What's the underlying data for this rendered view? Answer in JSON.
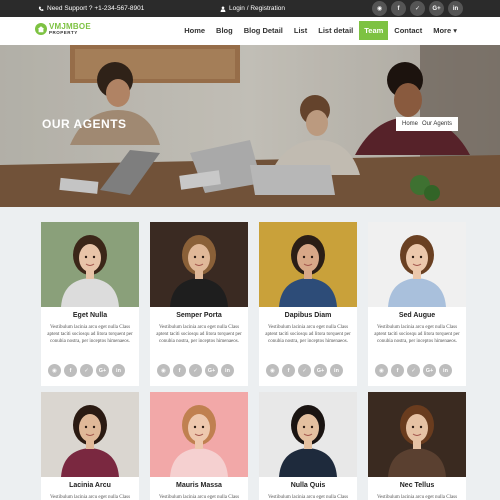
{
  "topbar": {
    "support_text": "Need Support ? +1-234-567-8901",
    "login_text": "Login / Registration",
    "social": [
      {
        "icon": "rss-icon",
        "label": "◉"
      },
      {
        "icon": "facebook-icon",
        "label": "f"
      },
      {
        "icon": "twitter-icon",
        "label": "✓"
      },
      {
        "icon": "google-plus-icon",
        "label": "G+"
      },
      {
        "icon": "linkedin-icon",
        "label": "in"
      }
    ]
  },
  "header": {
    "logo_name": "VMJMBOE",
    "logo_sub": "PROPERTY",
    "nav": [
      {
        "label": "Home"
      },
      {
        "label": "Blog"
      },
      {
        "label": "Blog Detail"
      },
      {
        "label": "List"
      },
      {
        "label": "List detail"
      },
      {
        "label": "Team",
        "active": true
      },
      {
        "label": "Contact"
      },
      {
        "label": "More ▾"
      }
    ]
  },
  "hero": {
    "title": "OUR AGENTS",
    "breadcrumb": [
      "Home",
      "Our Agents"
    ]
  },
  "card_social": [
    "◉",
    "f",
    "✓",
    "G+",
    "in"
  ],
  "agents": [
    {
      "name": "Eget Nulla",
      "desc": "Vestibulum lacinia arcu eget nulla Class aptent taciti sociosqu ad litora torquent per conubia nostra, per inceptos himenaeos.",
      "bg": "#8aa07a",
      "skin": "#e8c4a8",
      "hair": "#3b2618",
      "shirt": "#dcdcdc"
    },
    {
      "name": "Semper Porta",
      "desc": "Vestibulum lacinia arcu eget nulla Class aptent taciti sociosqu ad litora torquent per conubia nostra, per inceptos himenaeos.",
      "bg": "#3a2a22",
      "skin": "#e0b898",
      "hair": "#8a6038",
      "shirt": "#1e1e1e"
    },
    {
      "name": "Dapibus Diam",
      "desc": "Vestibulum lacinia arcu eget nulla Class aptent taciti sociosqu ad litora torquent per conubia nostra, per inceptos himenaeos.",
      "bg": "#c9a13a",
      "skin": "#d8a888",
      "hair": "#2a1e16",
      "shirt": "#2d4c78"
    },
    {
      "name": "Sed Augue",
      "desc": "Vestibulum lacinia arcu eget nulla Class aptent taciti sociosqu ad litora torquent per conubia nostra, per inceptos himenaeos.",
      "bg": "#f0f0f0",
      "skin": "#ecc8ac",
      "hair": "#6a4022",
      "shirt": "#a9c0dc"
    },
    {
      "name": "Lacinia Arcu",
      "desc": "Vestibulum lacinia arcu eget nulla Class aptent taciti sociosqu ad litora torquent per conubia nostra,",
      "bg": "#dad6d0",
      "skin": "#e0b898",
      "hair": "#2a1a12",
      "shirt": "#7a2840"
    },
    {
      "name": "Mauris Massa",
      "desc": "Vestibulum lacinia arcu eget nulla Class aptent taciti sociosqu ad litora torquent per conubia nostra,",
      "bg": "#f2a8a8",
      "skin": "#eec8ae",
      "hair": "#c08050",
      "shirt": "#f5d0d0"
    },
    {
      "name": "Nulla Quis",
      "desc": "Vestibulum lacinia arcu eget nulla Class aptent taciti sociosqu ad litora torquent per conubia nostra,",
      "bg": "#e8e8e8",
      "skin": "#e4c0a0",
      "hair": "#1a1412",
      "shirt": "#1e2a3c"
    },
    {
      "name": "Nec Tellus",
      "desc": "Vestibulum lacinia arcu eget nulla Class aptent taciti sociosqu ad litora torquent per conubia nostra,",
      "bg": "#3a2a20",
      "skin": "#e6c2a4",
      "hair": "#6a3c1e",
      "shirt": "#5a4030"
    }
  ]
}
